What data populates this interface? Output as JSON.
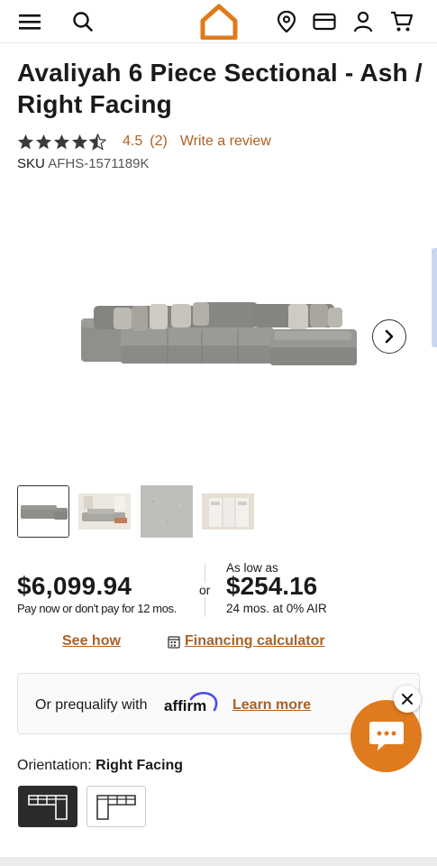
{
  "header": {
    "icons": [
      "menu-icon",
      "search-icon",
      "home-logo-icon",
      "location-pin-icon",
      "credit-card-icon",
      "account-icon",
      "cart-icon"
    ],
    "brand_color": "#e07a1e"
  },
  "product": {
    "title": "Avaliyah 6 Piece Sectional - Ash / Right Facing",
    "rating": 4.5,
    "rating_text": "4.5",
    "review_count": "(2)",
    "write_review": "Write a review",
    "sku_label": "SKU",
    "sku": "AFHS-1571189K"
  },
  "gallery": {
    "thumbnail_count": 4,
    "active_index": 0
  },
  "pricing": {
    "price": "$6,099.94",
    "price_note": "Pay now or don't pay for 12 mos.",
    "or": "or",
    "as_low_as": "As low as",
    "monthly": "$254.16",
    "monthly_note": "24 mos. at 0% AIR",
    "see_how": "See how",
    "financing_calculator": "Financing calculator"
  },
  "affirm": {
    "prequalify_text": "Or prequalify with",
    "logo_text": "affirm",
    "learn_more": "Learn more"
  },
  "orientation": {
    "label": "Orientation:",
    "selected": "Right Facing"
  },
  "colors": {
    "accent_link": "#b06020",
    "chat_orange": "#e07a1e",
    "affirm_blue": "#4a4af4"
  }
}
